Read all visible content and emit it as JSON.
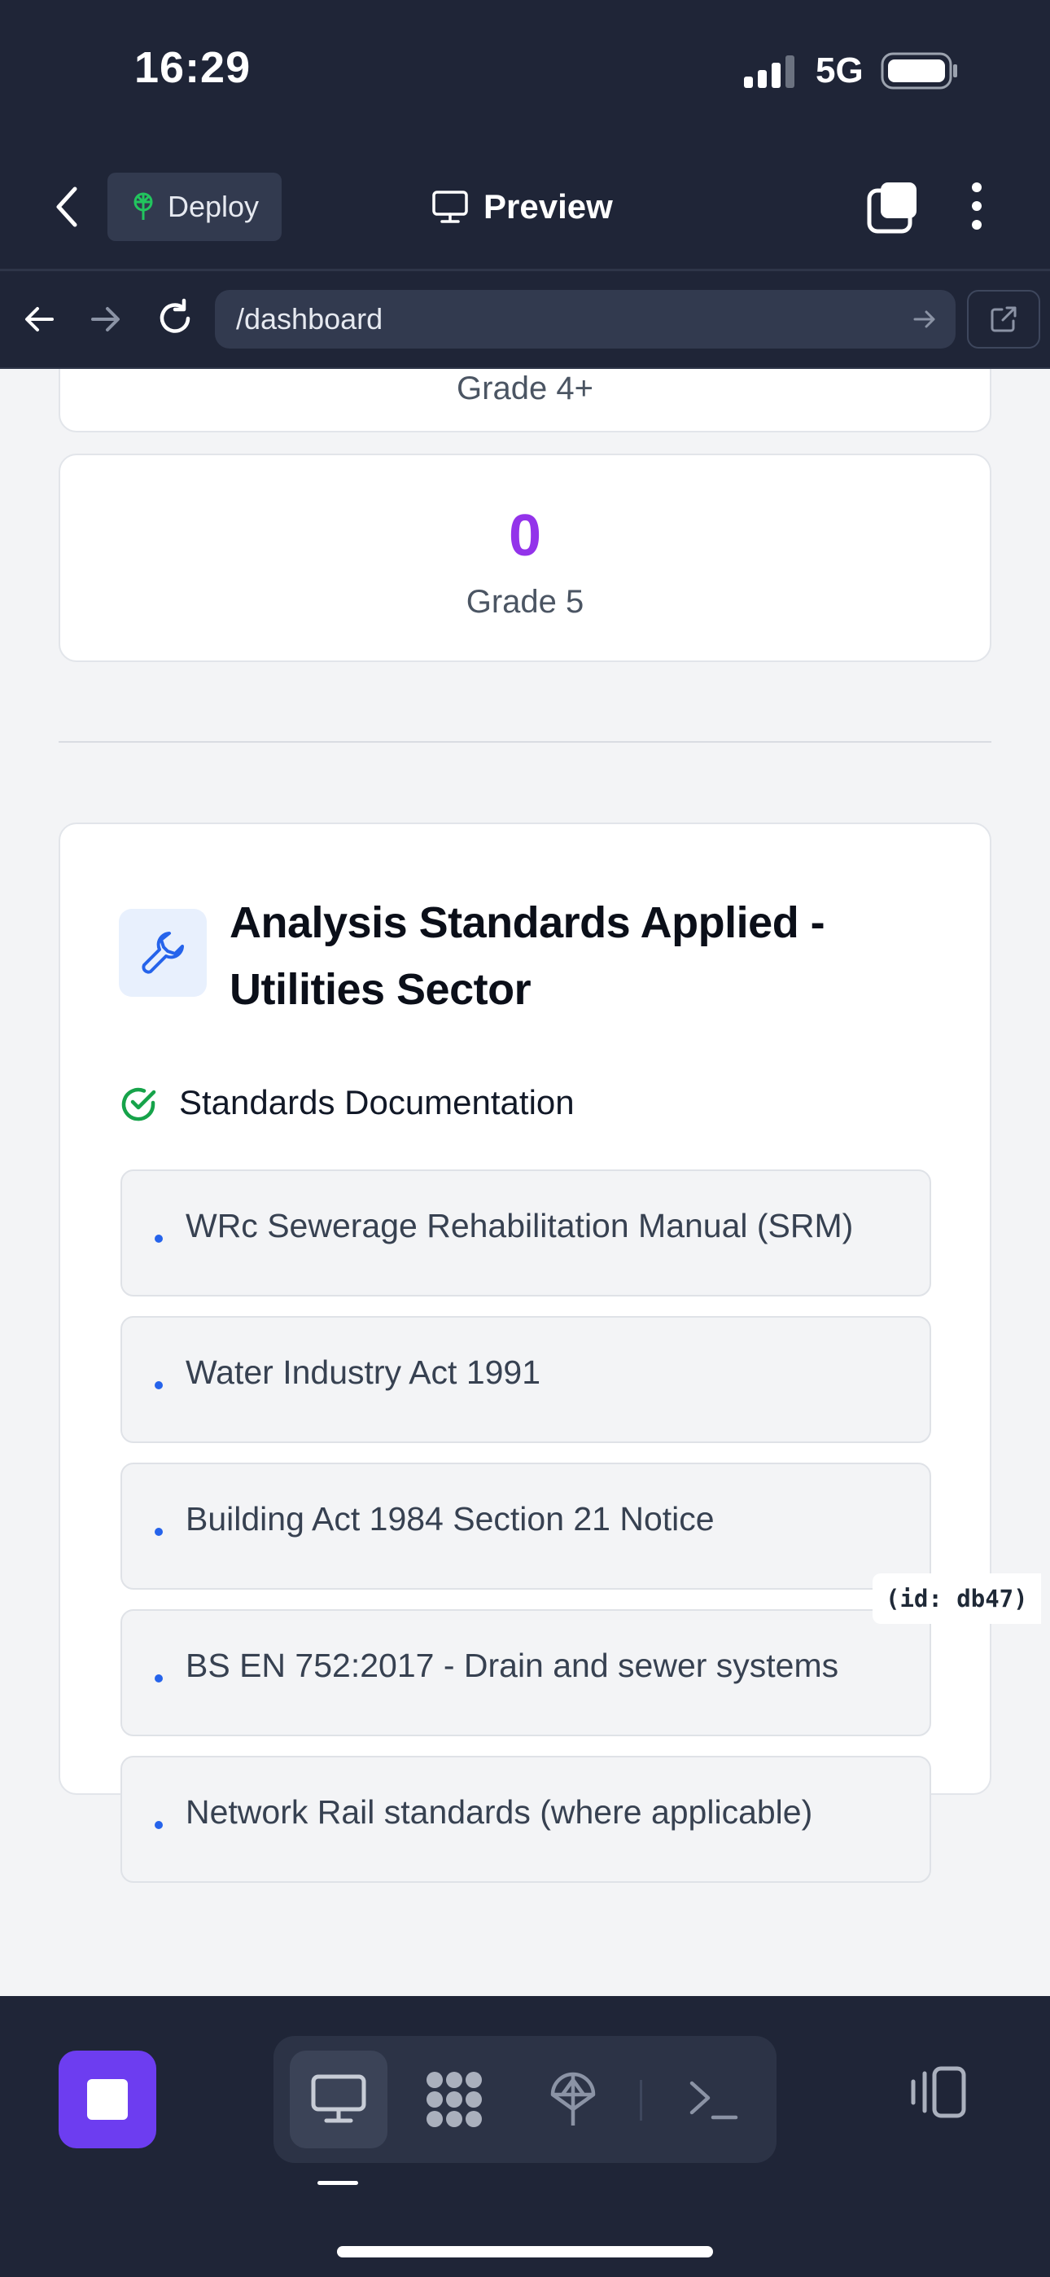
{
  "status_bar": {
    "time": "16:29",
    "network": "5G"
  },
  "header": {
    "deploy_label": "Deploy",
    "preview_label": "Preview"
  },
  "browser": {
    "url": "/dashboard"
  },
  "grades": [
    {
      "label": "Grade 4+"
    },
    {
      "value": "0",
      "label": "Grade 5"
    }
  ],
  "standards_card": {
    "title": "Analysis Standards Applied - Utilities Sector",
    "doc_heading": "Standards Documentation",
    "items": [
      "WRc Sewerage Rehabilitation Manual (SRM)",
      "Water Industry Act 1991",
      "Building Act 1984 Section 21 Notice",
      "BS EN 752:2017 - Drain and sewer systems",
      "Network Rail standards (where applicable)"
    ]
  },
  "id_tag": "(id: db47)",
  "colors": {
    "dark_bg": "#1f2537",
    "accent_purple": "#9333ea",
    "stop_button": "#6d3df0",
    "check_green": "#16a34a",
    "bullet_blue": "#2563eb"
  },
  "icons": [
    "back-chevron-icon",
    "deploy-icon",
    "monitor-icon",
    "tabs-icon",
    "more-icon",
    "arrow-left-icon",
    "arrow-right-icon",
    "reload-icon",
    "external-link-icon",
    "wrench-icon",
    "check-circle-icon",
    "stop-icon",
    "desktop-icon",
    "apps-icon",
    "deploy-tool-icon",
    "console-icon",
    "layout-toggle-icon"
  ]
}
